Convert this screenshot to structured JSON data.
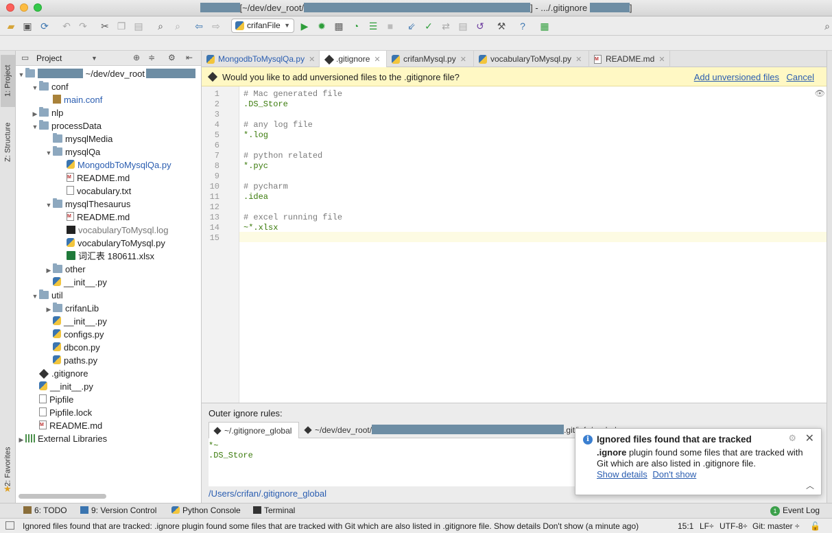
{
  "window": {
    "title_mid": "[~/dev/dev_root/",
    "title_end": "] - .../.gitignore",
    "title_tail": "]"
  },
  "toolbar": {
    "run_config": "crifanFile"
  },
  "sidebar": {
    "tabs": [
      "1: Project",
      "Z: Structure",
      "2: Favorites"
    ]
  },
  "project": {
    "header_label": "Project",
    "root_path": "~/dev/dev_root",
    "tree": [
      {
        "label": "conf",
        "type": "folder",
        "arrow": "▼"
      },
      {
        "label": "main.conf",
        "type": "conf"
      },
      {
        "label": "nlp",
        "type": "folder",
        "arrow": "▶"
      },
      {
        "label": "processData",
        "type": "folder",
        "arrow": "▼"
      },
      {
        "label": "mysqlMedia",
        "type": "folder"
      },
      {
        "label": "mysqlQa",
        "type": "folder",
        "arrow": "▼"
      },
      {
        "label": "MongodbToMysqlQa.py",
        "type": "py"
      },
      {
        "label": "README.md",
        "type": "md"
      },
      {
        "label": "vocabulary.txt",
        "type": "txt"
      },
      {
        "label": "mysqlThesaurus",
        "type": "folder",
        "arrow": "▼"
      },
      {
        "label": "README.md",
        "type": "md"
      },
      {
        "label": "vocabularyToMysql.log",
        "type": "log"
      },
      {
        "label": "vocabularyToMysql.py",
        "type": "py"
      },
      {
        "label": "词汇表 180611.xlsx",
        "type": "xls"
      },
      {
        "label": "other",
        "type": "folder",
        "arrow": "▶"
      },
      {
        "label": "__init__.py",
        "type": "py"
      },
      {
        "label": "util",
        "type": "folder",
        "arrow": "▼"
      },
      {
        "label": "crifanLib",
        "type": "folder",
        "arrow": "▶"
      },
      {
        "label": "__init__.py",
        "type": "py"
      },
      {
        "label": "configs.py",
        "type": "py"
      },
      {
        "label": "dbcon.py",
        "type": "py"
      },
      {
        "label": "paths.py",
        "type": "py"
      },
      {
        "label": ".gitignore",
        "type": "git"
      },
      {
        "label": "__init__.py",
        "type": "py"
      },
      {
        "label": "Pipfile",
        "type": "txt"
      },
      {
        "label": "Pipfile.lock",
        "type": "txt"
      },
      {
        "label": "README.md",
        "type": "md"
      },
      {
        "label": "External Libraries",
        "type": "lib",
        "arrow": "▶"
      }
    ]
  },
  "editor_tabs": [
    {
      "label": "MongodbToMysqlQa.py",
      "type": "py"
    },
    {
      "label": ".gitignore",
      "type": "git"
    },
    {
      "label": "crifanMysql.py",
      "type": "py"
    },
    {
      "label": "vocabularyToMysql.py",
      "type": "py"
    },
    {
      "label": "README.md",
      "type": "md"
    }
  ],
  "banner": {
    "text": "Would you like to add unversioned files to the .gitignore file?",
    "add": "Add unversioned files",
    "cancel": "Cancel"
  },
  "editor": {
    "lines": [
      {
        "n": "1",
        "text": "# Mac generated file",
        "kind": "comment"
      },
      {
        "n": "2",
        "text": ".DS_Store",
        "kind": "green"
      },
      {
        "n": "3",
        "text": "",
        "kind": "plain"
      },
      {
        "n": "4",
        "text": "# any log file",
        "kind": "comment"
      },
      {
        "n": "5",
        "text": "*.log",
        "kind": "green"
      },
      {
        "n": "6",
        "text": "",
        "kind": "plain"
      },
      {
        "n": "7",
        "text": "# python related",
        "kind": "comment"
      },
      {
        "n": "8",
        "text": "*.pyc",
        "kind": "green"
      },
      {
        "n": "9",
        "text": "",
        "kind": "plain"
      },
      {
        "n": "10",
        "text": "# pycharm",
        "kind": "comment"
      },
      {
        "n": "11",
        "text": ".idea",
        "kind": "green"
      },
      {
        "n": "12",
        "text": "",
        "kind": "plain"
      },
      {
        "n": "13",
        "text": "# excel running file",
        "kind": "comment"
      },
      {
        "n": "14",
        "text": "~*.xlsx",
        "kind": "green"
      },
      {
        "n": "15",
        "text": "",
        "kind": "plain"
      }
    ]
  },
  "outer": {
    "label": "Outer ignore rules:",
    "tab1": "~/.gitignore_global",
    "tab2": "~/dev/dev_root/",
    "tab2_end": ".git/info/exclude",
    "content": [
      "*~",
      ".DS_Store"
    ],
    "path": "/Users/crifan/.gitignore_global"
  },
  "popup": {
    "title": "Ignored files found that are tracked",
    "body_bold": ".ignore",
    "body": " plugin found some files that are tracked with Git which are also listed in .gitignore file.",
    "show_details": "Show details",
    "dont_show": "Don't show"
  },
  "toolwindows": {
    "todo": "6: TODO",
    "vcs": "9: Version Control",
    "console": "Python Console",
    "terminal": "Terminal",
    "event_log_count": "1",
    "event_log": "Event Log"
  },
  "status": {
    "message": "Ignored files found that are tracked: .ignore plugin found some files that are tracked with Git which are also listed in .gitignore file. Show details Don't show (a minute ago)",
    "position": "15:1",
    "line_sep": "LF÷",
    "encoding": "UTF-8÷",
    "branch": "Git: master ÷"
  },
  "colors": {
    "accent": "#2a5db0",
    "banner_bg": "#fff8c4",
    "green_code": "#3a7a0a"
  }
}
